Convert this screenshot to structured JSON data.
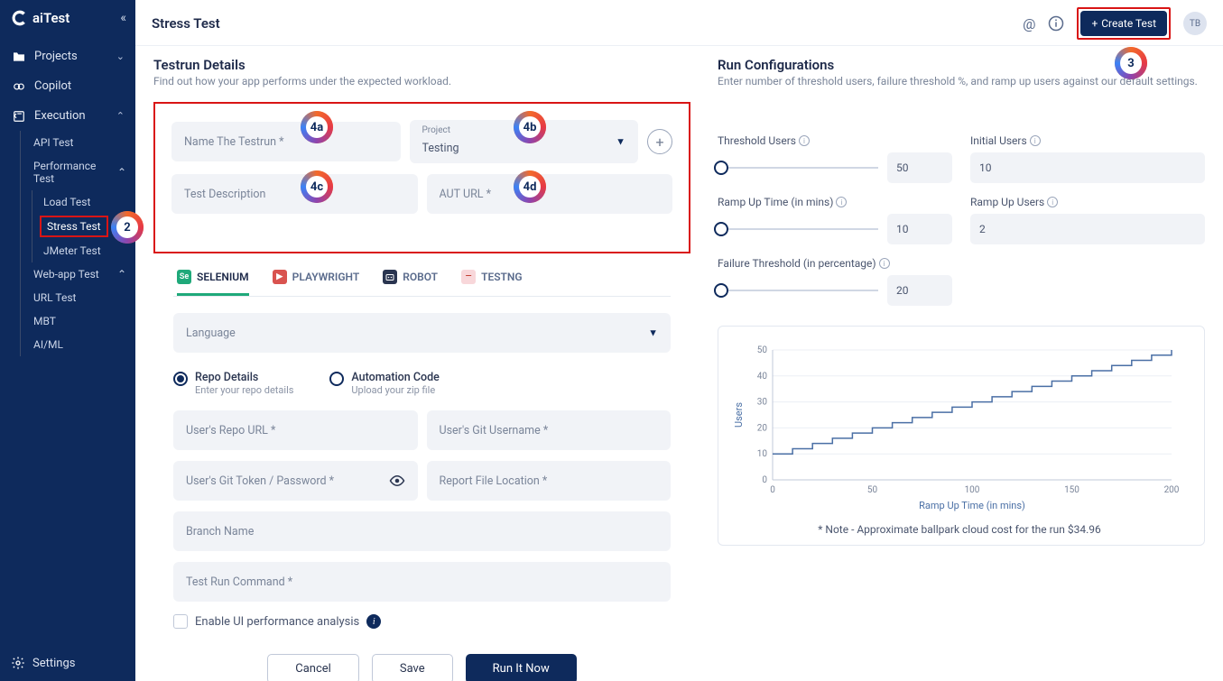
{
  "brand": "aiTest",
  "sidebar": {
    "items": [
      {
        "label": "Projects"
      },
      {
        "label": "Copilot"
      },
      {
        "label": "Execution"
      }
    ],
    "exec_children": [
      {
        "label": "API Test"
      },
      {
        "label": "Performance Test",
        "children": [
          {
            "label": "Load Test"
          },
          {
            "label": "Stress Test"
          },
          {
            "label": "JMeter Test"
          }
        ]
      },
      {
        "label": "Web-app Test"
      },
      {
        "label": "URL Test"
      },
      {
        "label": "MBT"
      },
      {
        "label": "AI/ML"
      }
    ],
    "settings": "Settings"
  },
  "header": {
    "title": "Stress Test",
    "create": "Create Test",
    "avatar": "TB"
  },
  "left": {
    "title": "Testrun Details",
    "sub": "Find out how your app performs under the expected workload.",
    "fields": {
      "name_ph": "Name The Testrun *",
      "project_label": "Project",
      "project_value": "Testing",
      "desc_ph": "Test Description",
      "aut_ph": "AUT URL *"
    },
    "frameworks": [
      {
        "label": "SELENIUM"
      },
      {
        "label": "PLAYWRIGHT"
      },
      {
        "label": "ROBOT"
      },
      {
        "label": "TESTNG"
      }
    ],
    "lang_ph": "Language",
    "radios": {
      "repo_title": "Repo Details",
      "repo_sub": "Enter your repo details",
      "auto_title": "Automation Code",
      "auto_sub": "Upload your zip file"
    },
    "repo_fields": {
      "url": "User's Repo URL *",
      "username": "User's Git Username *",
      "token": "User's Git Token / Password *",
      "report": "Report File Location *",
      "branch": "Branch Name",
      "cmd": "Test Run Command *"
    },
    "checkbox": "Enable UI performance analysis",
    "buttons": {
      "cancel": "Cancel",
      "save": "Save",
      "run": "Run It Now"
    }
  },
  "right": {
    "title": "Run Configurations",
    "sub": "Enter number of threshold users, failure threshold %, and ramp up users against our default settings.",
    "cfg": {
      "threshold_label": "Threshold Users",
      "threshold_val": "50",
      "initial_label": "Initial Users",
      "initial_val": "10",
      "ramp_time_label": "Ramp Up Time (in mins)",
      "ramp_time_val": "10",
      "ramp_users_label": "Ramp Up Users",
      "ramp_users_val": "2",
      "failure_label": "Failure Threshold (in percentage)",
      "failure_val": "20"
    },
    "note": "* Note - Approximate ballpark cloud cost for the run $34.96"
  },
  "chart_data": {
    "type": "line",
    "title": "",
    "xlabel": "Ramp Up Time (in mins)",
    "ylabel": "Users",
    "xlim": [
      0,
      200
    ],
    "ylim": [
      0,
      50
    ],
    "x_ticks": [
      0,
      50,
      100,
      150,
      200
    ],
    "y_ticks": [
      0,
      10,
      20,
      30,
      40,
      50
    ],
    "series": [
      {
        "name": "Users",
        "x": [
          0,
          10,
          20,
          30,
          40,
          50,
          60,
          70,
          80,
          90,
          100,
          110,
          120,
          130,
          140,
          150,
          160,
          170,
          180,
          190,
          200
        ],
        "values": [
          10,
          12,
          14,
          16,
          18,
          20,
          22,
          24,
          26,
          28,
          30,
          32,
          34,
          36,
          38,
          40,
          42,
          44,
          46,
          48,
          50
        ]
      }
    ]
  },
  "annotations": {
    "b2": "2",
    "b3": "3",
    "b4a": "4a",
    "b4b": "4b",
    "b4c": "4c",
    "b4d": "4d"
  }
}
